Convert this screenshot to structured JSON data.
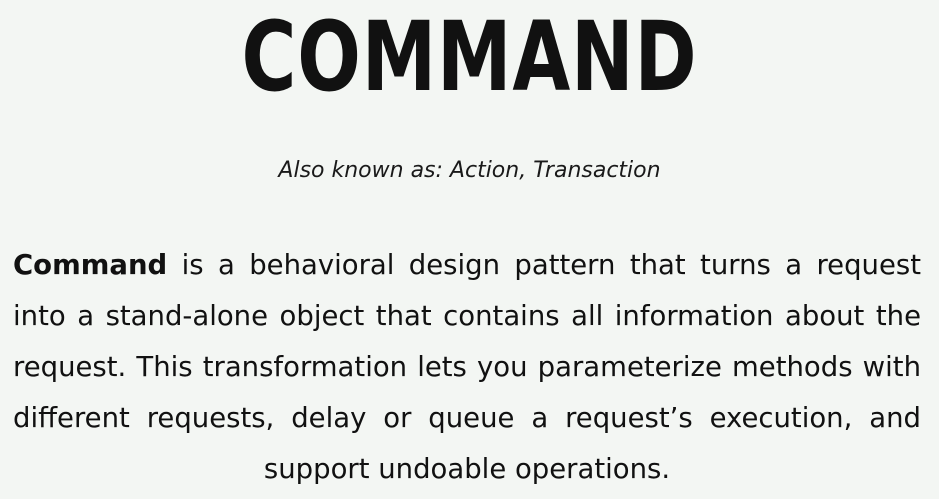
{
  "title": "COMMAND",
  "also_known_as": "Also known as: Action, Transaction",
  "intro": {
    "term": "Command",
    "text": " is a behavioral design pattern that turns a request into a stand-alone object that contains all information about the request. This transformation lets you parameterize methods with different requests, delay or queue a request’s execution, and support undoable operations."
  }
}
